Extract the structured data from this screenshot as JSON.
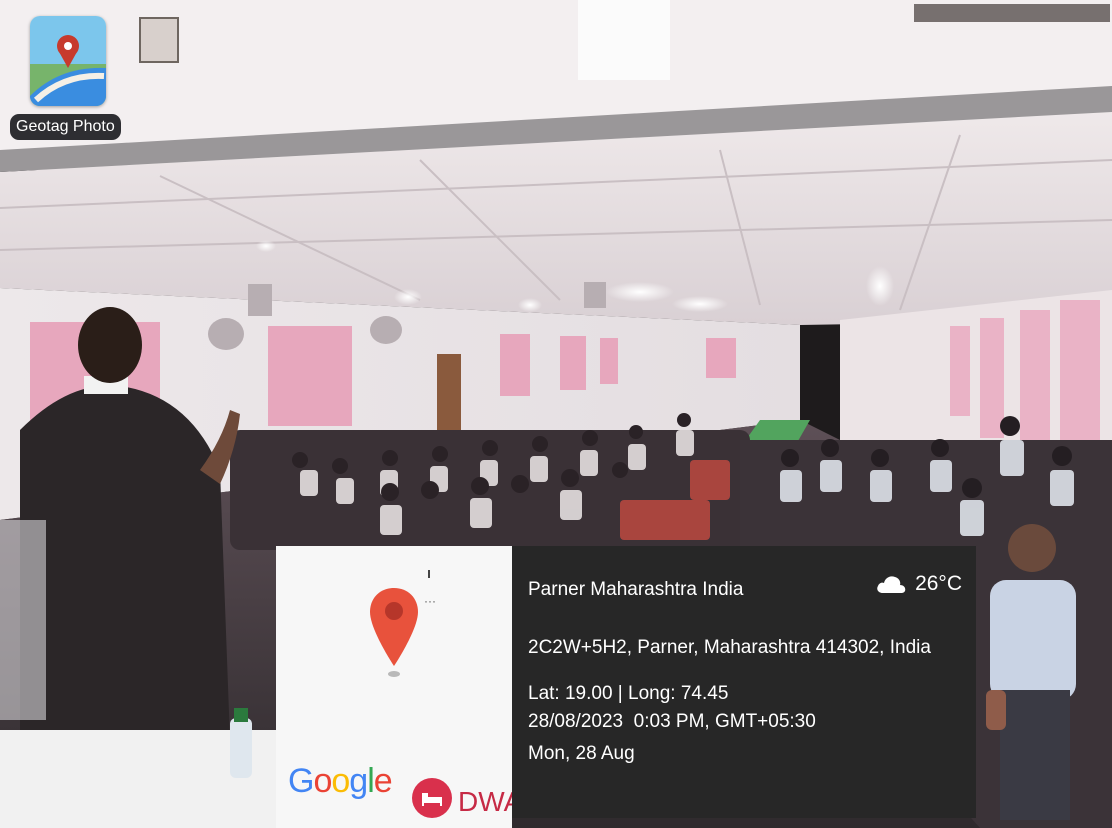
{
  "app": {
    "name": "Geotag Photo"
  },
  "overlay": {
    "location_title": "Parner Maharashtra India",
    "temperature": "26°C",
    "weather_icon": "cloud-icon",
    "address": "2C2W+5H2, Parner, Maharashtra 414302, India",
    "lat_long": "Lat: 19.00 | Long: 74.45",
    "datetime": "28/08/2023  0:03 PM, GMT+05:30",
    "day": "Mon, 28 Aug"
  },
  "map_card": {
    "brand_logo": "Google",
    "badge_text": "DWA",
    "pin_icon": "map-pin-icon",
    "colors": {
      "pin": "#e8523c",
      "badge": "#d9304c"
    }
  }
}
